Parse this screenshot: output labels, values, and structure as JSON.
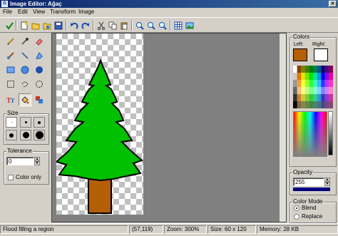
{
  "window": {
    "title": "Image Editor: Ağaç",
    "app_icon": "G",
    "close_glyph": "✕"
  },
  "menu": [
    {
      "label": "File"
    },
    {
      "label": "Edit"
    },
    {
      "label": "View"
    },
    {
      "label": "Transform"
    },
    {
      "label": "Image"
    }
  ],
  "toolbar": {
    "icons": [
      "check-icon",
      "new-icon",
      "open-icon",
      "open-file-icon",
      "save-icon",
      "undo-icon",
      "redo-icon",
      "cut-icon",
      "copy-icon",
      "paste-icon",
      "zoom-in-icon",
      "zoom-out-icon",
      "zoom-fit-icon",
      "grid-icon",
      "image-icon"
    ]
  },
  "tools": {
    "icons": [
      "pencil-icon",
      "color-picker-icon",
      "eraser-icon",
      "brush-icon",
      "line-icon",
      "polygon-icon",
      "rectangle-icon",
      "ellipse-icon",
      "filled-ellipse-icon",
      "rect-select-icon",
      "lasso-icon",
      "magic-wand-icon",
      "text-icon",
      "flood-fill-icon",
      "replace-color-icon"
    ],
    "selected": "flood-fill-icon"
  },
  "size": {
    "label": "Size"
  },
  "tolerance": {
    "label": "Tolerance",
    "value": "0",
    "color_only_label": "Color only"
  },
  "colors": {
    "label": "Colors",
    "left_label": "Left:",
    "right_label": "Right:",
    "left_color": "#b45f06",
    "right_color": "#ffffff"
  },
  "opacity": {
    "label": "Opacity",
    "value": "255"
  },
  "color_mode": {
    "label": "Color Mode",
    "options": [
      {
        "label": "Blend",
        "selected": true
      },
      {
        "label": "Replace",
        "selected": false
      }
    ]
  },
  "status": {
    "message": "Flood filling a region",
    "coords": "(57,119)",
    "zoom": "Zoom: 300%",
    "size": "Size: 60 x 120",
    "memory": "Memory: 28 KB"
  }
}
